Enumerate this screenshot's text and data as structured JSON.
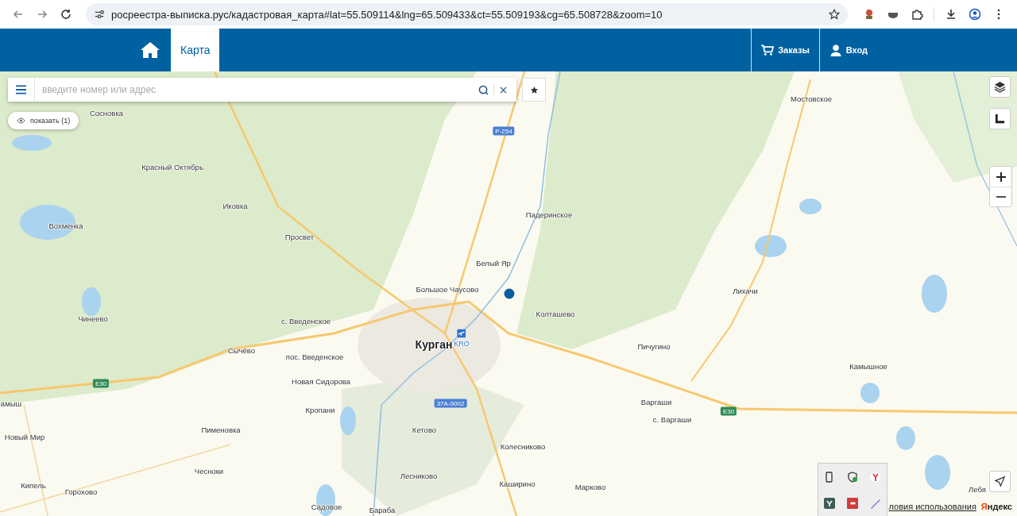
{
  "browser": {
    "url": "росреестра-выписка.рус/кадастровая_карта#lat=55.509114&lng=65.509433&ct=55.509193&cg=65.508728&zoom=10"
  },
  "header": {
    "tabs": [
      {
        "label": "Карта",
        "selected": true
      }
    ],
    "actions": [
      {
        "label": "Заказы",
        "kind": "cart"
      },
      {
        "label": "Вход",
        "kind": "user"
      }
    ]
  },
  "search": {
    "placeholder": "введите номер или адрес"
  },
  "show_button": {
    "label": "показать (1)"
  },
  "map": {
    "labels": [
      {
        "text": "Сосновка",
        "kind": "village"
      },
      {
        "text": "Красный Октябрь",
        "kind": "village"
      },
      {
        "text": "Иковка",
        "kind": "village"
      },
      {
        "text": "Вохменка",
        "kind": "village"
      },
      {
        "text": "Просвет",
        "kind": "village"
      },
      {
        "text": "Чинеево",
        "kind": "village"
      },
      {
        "text": "с. Введенское",
        "kind": "village"
      },
      {
        "text": "Сычёво",
        "kind": "village"
      },
      {
        "text": "пос. Введенское",
        "kind": "village"
      },
      {
        "text": "Новая Сидорова",
        "kind": "village"
      },
      {
        "text": "Кропани",
        "kind": "village"
      },
      {
        "text": "Пименовка",
        "kind": "village"
      },
      {
        "text": "Новый Мир",
        "kind": "village"
      },
      {
        "text": "Чесноки",
        "kind": "village"
      },
      {
        "text": "Кипель",
        "kind": "village"
      },
      {
        "text": "Горохово",
        "kind": "village"
      },
      {
        "text": "Садовое",
        "kind": "village"
      },
      {
        "text": "амыш",
        "kind": "village"
      },
      {
        "text": "Мостовское",
        "kind": "village"
      },
      {
        "text": "Падеринское",
        "kind": "village"
      },
      {
        "text": "Белый Яр",
        "kind": "village"
      },
      {
        "text": "Большое Чаусово",
        "kind": "village"
      },
      {
        "text": "Колташево",
        "kind": "village"
      },
      {
        "text": "Курган",
        "kind": "city"
      },
      {
        "text": "KRO",
        "kind": "airport"
      },
      {
        "text": "Пичугино",
        "kind": "village"
      },
      {
        "text": "Лихачи",
        "kind": "village"
      },
      {
        "text": "Камышное",
        "kind": "village"
      },
      {
        "text": "Варгаши",
        "kind": "village"
      },
      {
        "text": "с. Варгаши",
        "kind": "village"
      },
      {
        "text": "Кетово",
        "kind": "village"
      },
      {
        "text": "Колесниково",
        "kind": "village"
      },
      {
        "text": "Лесниково",
        "kind": "village"
      },
      {
        "text": "Каширино",
        "kind": "village"
      },
      {
        "text": "Марково",
        "kind": "village"
      },
      {
        "text": "Бараба",
        "kind": "village"
      },
      {
        "text": "Лебя",
        "kind": "village"
      }
    ],
    "road_signs": [
      {
        "text": "Р-254",
        "color": "#4a7fd4"
      },
      {
        "text": "E30",
        "color": "#2e8b57"
      },
      {
        "text": "E30",
        "color": "#2e8b57"
      },
      {
        "text": "37А-0002",
        "color": "#4a7fd4"
      }
    ],
    "terms_link": "ловия использования",
    "logo": "Яндекс"
  }
}
